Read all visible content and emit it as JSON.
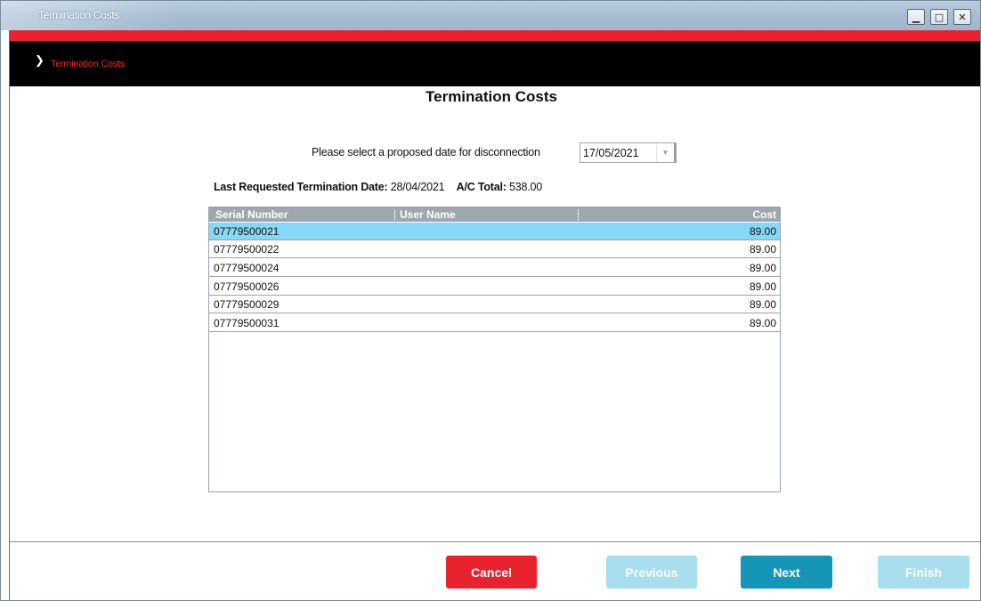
{
  "window": {
    "title": "Termination Costs",
    "controls": {
      "minimize": "▁",
      "maximize": "□",
      "close": "✕"
    }
  },
  "breadcrumb": {
    "chevron_icon": "chevron-right",
    "label": "Termination Costs"
  },
  "page": {
    "title": "Termination Costs"
  },
  "date_prompt": {
    "label": "Please select a proposed date for disconnection",
    "selected": "17/05/2021"
  },
  "info": {
    "last_requested_label": "Last Requested Termination Date:",
    "last_requested_value": "28/04/2021",
    "total_label": "A/C Total:",
    "total_value": "538.00"
  },
  "table": {
    "headers": {
      "serial": "Serial Number",
      "user": "User Name",
      "cost": "Cost"
    },
    "rows": [
      {
        "serial": "07779500021",
        "user": "",
        "cost": "89.00"
      },
      {
        "serial": "07779500022",
        "user": "",
        "cost": "89.00"
      },
      {
        "serial": "07779500024",
        "user": "",
        "cost": "89.00"
      },
      {
        "serial": "07779500026",
        "user": "",
        "cost": "89.00"
      },
      {
        "serial": "07779500029",
        "user": "",
        "cost": "89.00"
      },
      {
        "serial": "07779500031",
        "user": "",
        "cost": "89.00"
      }
    ],
    "selected_row": 0
  },
  "buttons": {
    "cancel": "Cancel",
    "previous": "Previous",
    "next": "Next",
    "finish": "Finish"
  },
  "colors": {
    "accent_red": "#e8222e",
    "accent_teal": "#1595b7",
    "disabled_teal": "#a8deee",
    "selection": "#87d7f6"
  }
}
